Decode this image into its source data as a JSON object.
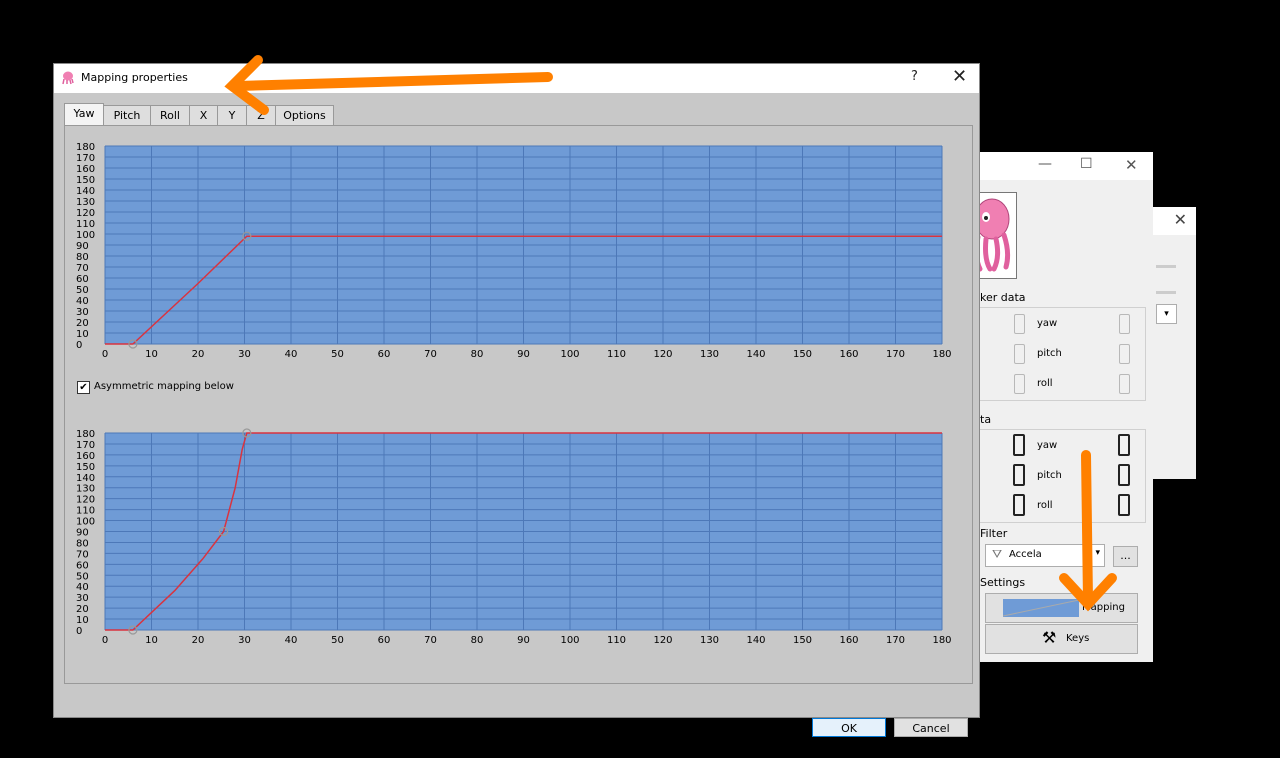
{
  "dialog": {
    "title": "Mapping properties",
    "help": "?",
    "close": "✕",
    "tabs": [
      "Yaw",
      "Pitch",
      "Roll",
      "X",
      "Y",
      "Z",
      "Options"
    ],
    "active_tab": "Yaw",
    "checkbox_label": "Asymmetric mapping below",
    "checkbox_checked": true,
    "ok_label": "OK",
    "cancel_label": "Cancel"
  },
  "background_window": {
    "minimize": "—",
    "maximize": "☐",
    "close": "✕",
    "raw_group_label": "ker data",
    "game_group_label": "ta",
    "rows": [
      "yaw",
      "pitch",
      "roll"
    ],
    "filter_label": "Filter",
    "filter_value": "Accela",
    "filter_more": "...",
    "settings_label": "Settings",
    "mapping_button": "Mapping",
    "keys_button": "Keys"
  },
  "background_window_2": {
    "close": "✕"
  },
  "colors": {
    "plot_bg": "#6f9bd6",
    "grid": "#4d78b8",
    "curve": "#d9333f",
    "arrow": "#ff8000"
  },
  "chart_data": [
    {
      "type": "line",
      "xlim": [
        0,
        180
      ],
      "ylim": [
        0,
        180
      ],
      "x_ticks": [
        0,
        10,
        20,
        30,
        40,
        50,
        60,
        70,
        80,
        90,
        100,
        110,
        120,
        130,
        140,
        150,
        160,
        170,
        180
      ],
      "y_ticks": [
        0,
        10,
        20,
        30,
        40,
        50,
        60,
        70,
        80,
        90,
        100,
        110,
        120,
        130,
        140,
        150,
        160,
        170,
        180
      ],
      "series": [
        {
          "x": [
            0,
            6,
            20,
            30.5,
            180
          ],
          "y": [
            0,
            0,
            55,
            98,
            98
          ]
        }
      ],
      "control_points": [
        {
          "x": 6,
          "y": 0
        },
        {
          "x": 30.5,
          "y": 98
        }
      ]
    },
    {
      "type": "line",
      "xlim": [
        0,
        180
      ],
      "ylim": [
        0,
        180
      ],
      "x_ticks": [
        0,
        10,
        20,
        30,
        40,
        50,
        60,
        70,
        80,
        90,
        100,
        110,
        120,
        130,
        140,
        150,
        160,
        170,
        180
      ],
      "y_ticks": [
        0,
        10,
        20,
        30,
        40,
        50,
        60,
        70,
        80,
        90,
        100,
        110,
        120,
        130,
        140,
        150,
        160,
        170,
        180
      ],
      "series": [
        {
          "x": [
            0,
            6,
            15,
            21,
            25.5,
            28,
            29.5,
            30.5,
            180
          ],
          "y": [
            0,
            0,
            36,
            65,
            90,
            130,
            165,
            180,
            180
          ]
        }
      ],
      "control_points": [
        {
          "x": 6,
          "y": 0
        },
        {
          "x": 25.5,
          "y": 90
        },
        {
          "x": 30.5,
          "y": 180
        }
      ]
    }
  ]
}
